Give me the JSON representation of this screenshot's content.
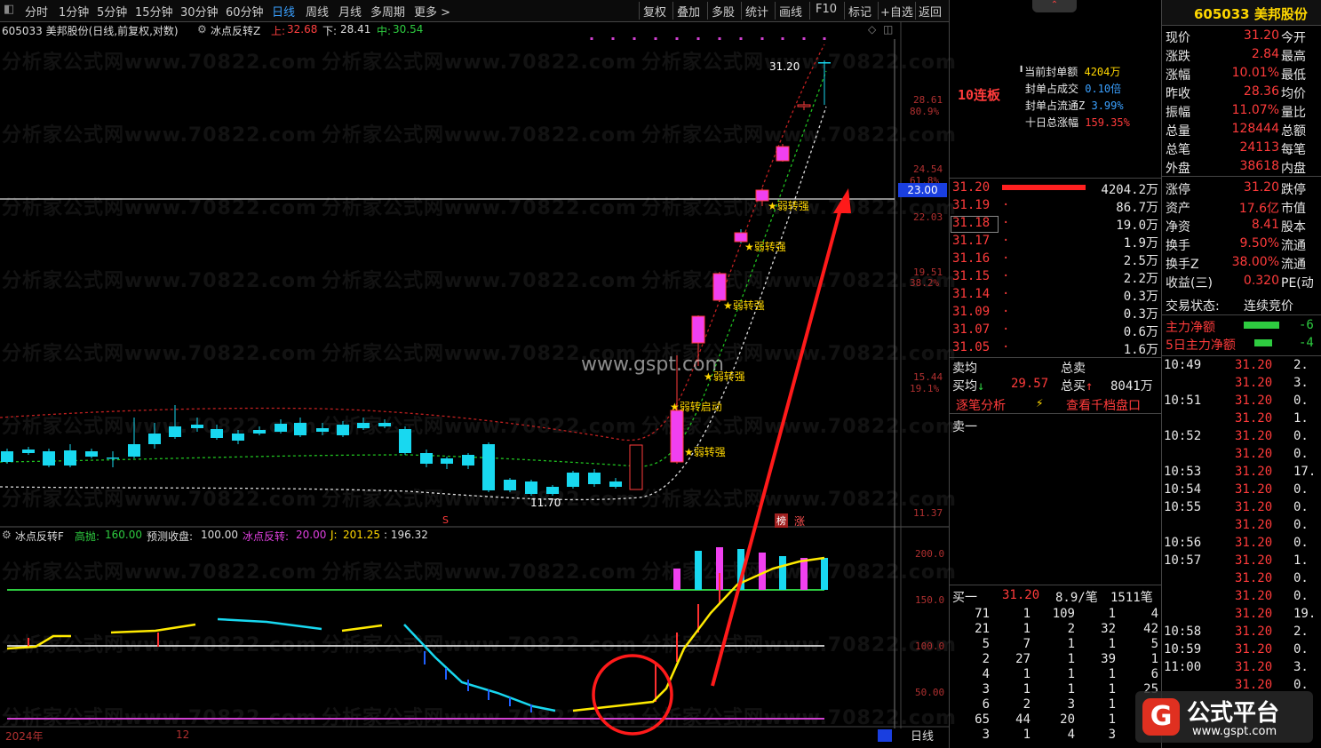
{
  "toolbar": {
    "periods": [
      "分时",
      "1分钟",
      "5分钟",
      "15分钟",
      "30分钟",
      "60分钟",
      "日线",
      "周线",
      "月线",
      "多周期",
      "更多 >"
    ],
    "active_period": "日线",
    "actions": [
      "复权",
      "叠加",
      "多股",
      "统计",
      "画线",
      "F10",
      "标记",
      "+自选",
      "返回"
    ]
  },
  "chart_header": {
    "stock": "605033 美邦股份(日线,前复权,对数)",
    "indicator": "冰点反转Z",
    "upper_label": "上:",
    "upper_value": "32.68",
    "lower_label": "下:",
    "lower_value": "28.41",
    "mid_label": "中:",
    "mid_value": "30.54"
  },
  "price_axis": {
    "labels": [
      "28.61",
      "80.9%",
      "24.54",
      "61.8%",
      "22.03",
      "19.51",
      "38.2%",
      "15.44",
      "19.1%",
      "11.37"
    ],
    "cursor_value": "23.00"
  },
  "main_chart": {
    "high_label": "31.20",
    "low_label": "11.70",
    "signals": [
      "弱转强",
      "弱转强",
      "弱转强",
      "弱转强",
      "弱转启动",
      "弱转强"
    ],
    "badges": [
      "榜",
      "涨"
    ],
    "marker_s": "S"
  },
  "sub_header": {
    "name": "冰点反转F",
    "a_label": "高抛:",
    "a_value": "160.00",
    "b_label": "预测收盘:",
    "b_value": "100.00",
    "c_label": "冰点反转:",
    "c_value": "20.00",
    "d_label": "J:",
    "d_value": "201.25",
    "e_value": ": 196.32"
  },
  "sub_axis": [
    "200.0",
    "150.0",
    "100.0",
    "50.00"
  ],
  "time_axis": {
    "year": "2024年",
    "month": "12",
    "period_label": "日线"
  },
  "watermark": "分析家公式网www.70822.com",
  "gspt_watermark": "www.gspt.com",
  "seal_panel": {
    "limit_tag": "10连板",
    "rows": [
      {
        "label": "当前封单额",
        "value": "4204万"
      },
      {
        "label": "封单占成交",
        "value": "0.10倍"
      },
      {
        "label": "封单占流通Z",
        "value": "3.99%"
      },
      {
        "label": "十日总涨幅",
        "value": "159.35%"
      }
    ]
  },
  "order_book": {
    "asks": [
      {
        "price": "31.20",
        "vol": "4204.2万"
      },
      {
        "price": "31.19",
        "vol": "86.7万"
      },
      {
        "price": "31.18",
        "vol": "19.0万"
      },
      {
        "price": "31.17",
        "vol": "1.9万"
      },
      {
        "price": "31.16",
        "vol": "2.5万"
      },
      {
        "price": "31.15",
        "vol": "2.2万"
      },
      {
        "price": "31.14",
        "vol": "0.3万"
      },
      {
        "price": "31.09",
        "vol": "0.3万"
      },
      {
        "price": "31.07",
        "vol": "0.6万"
      },
      {
        "price": "31.05",
        "vol": "1.6万"
      }
    ],
    "sell_avg_label": "卖均",
    "total_sell_label": "总卖",
    "buy_avg_label": "买均",
    "buy_avg_value": "29.57",
    "total_buy_label": "总买",
    "total_buy_value": "8041万",
    "link_left": "逐笔分析",
    "link_right": "查看千档盘口",
    "sell1_label": "卖一",
    "buy1_label": "买一",
    "buy1_price": "31.20",
    "buy1_detail": "8.9/笔",
    "buy1_count": "1511笔"
  },
  "queue": [
    [
      "71",
      "1",
      "109",
      "1",
      "4"
    ],
    [
      "21",
      "1",
      "2",
      "32",
      "42"
    ],
    [
      "5",
      "7",
      "1",
      "1",
      "5"
    ],
    [
      "2",
      "27",
      "1",
      "39",
      "1"
    ],
    [
      "4",
      "1",
      "1",
      "1",
      "6"
    ],
    [
      "3",
      "1",
      "1",
      "1",
      "25"
    ],
    [
      "6",
      "2",
      "3",
      "1",
      "2"
    ],
    [
      "65",
      "44",
      "20",
      "1",
      "8"
    ],
    [
      "3",
      "1",
      "4",
      "3",
      ""
    ]
  ],
  "quote": {
    "title": "605033 美邦股份",
    "rows": [
      {
        "l": "现价",
        "v": "31.20",
        "r": "今开"
      },
      {
        "l": "涨跌",
        "v": "2.84",
        "r": "最高"
      },
      {
        "l": "涨幅",
        "v": "10.01%",
        "r": "最低"
      },
      {
        "l": "昨收",
        "v": "28.36",
        "r": "均价"
      },
      {
        "l": "振幅",
        "v": "11.07%",
        "r": "量比"
      },
      {
        "l": "总量",
        "v": "128444",
        "r": "总额"
      },
      {
        "l": "总笔",
        "v": "24113",
        "r": "每笔"
      },
      {
        "l": "外盘",
        "v": "38618",
        "r": "内盘"
      }
    ],
    "rows2": [
      {
        "l": "涨停",
        "v": "31.20",
        "r": "跌停"
      },
      {
        "l": "资产",
        "v": "17.6亿",
        "r": "市值"
      },
      {
        "l": "净资",
        "v": "8.41",
        "r": "股本"
      },
      {
        "l": "换手",
        "v": "9.50%",
        "r": "流通"
      },
      {
        "l": "换手Z",
        "v": "38.00%",
        "r": "流通"
      },
      {
        "l": "收益(三)",
        "v": "0.320",
        "r": "PE(动"
      }
    ],
    "trade_state_label": "交易状态:",
    "trade_state_value": "连续竞价",
    "main_net_label": "主力净额",
    "main_net_value": "-6",
    "main_net5_label": "5日主力净额",
    "main_net5_value": "-4"
  },
  "ticks": [
    {
      "t": "10:49",
      "p": "31.20",
      "v": "2."
    },
    {
      "t": "",
      "p": "31.20",
      "v": "3."
    },
    {
      "t": "10:51",
      "p": "31.20",
      "v": "0."
    },
    {
      "t": "",
      "p": "31.20",
      "v": "1."
    },
    {
      "t": "10:52",
      "p": "31.20",
      "v": "0."
    },
    {
      "t": "",
      "p": "31.20",
      "v": "0."
    },
    {
      "t": "10:53",
      "p": "31.20",
      "v": "17."
    },
    {
      "t": "10:54",
      "p": "31.20",
      "v": "0."
    },
    {
      "t": "10:55",
      "p": "31.20",
      "v": "0."
    },
    {
      "t": "",
      "p": "31.20",
      "v": "0."
    },
    {
      "t": "10:56",
      "p": "31.20",
      "v": "0."
    },
    {
      "t": "10:57",
      "p": "31.20",
      "v": "1."
    },
    {
      "t": "",
      "p": "31.20",
      "v": "0."
    },
    {
      "t": "",
      "p": "31.20",
      "v": "0."
    },
    {
      "t": "",
      "p": "31.20",
      "v": "19."
    },
    {
      "t": "10:58",
      "p": "31.20",
      "v": "2."
    },
    {
      "t": "10:59",
      "p": "31.20",
      "v": "0."
    },
    {
      "t": "11:00",
      "p": "31.20",
      "v": "3."
    },
    {
      "t": "",
      "p": "31.20",
      "v": "0."
    }
  ],
  "logo": {
    "title": "公式平台",
    "url": "www.gspt.com"
  }
}
